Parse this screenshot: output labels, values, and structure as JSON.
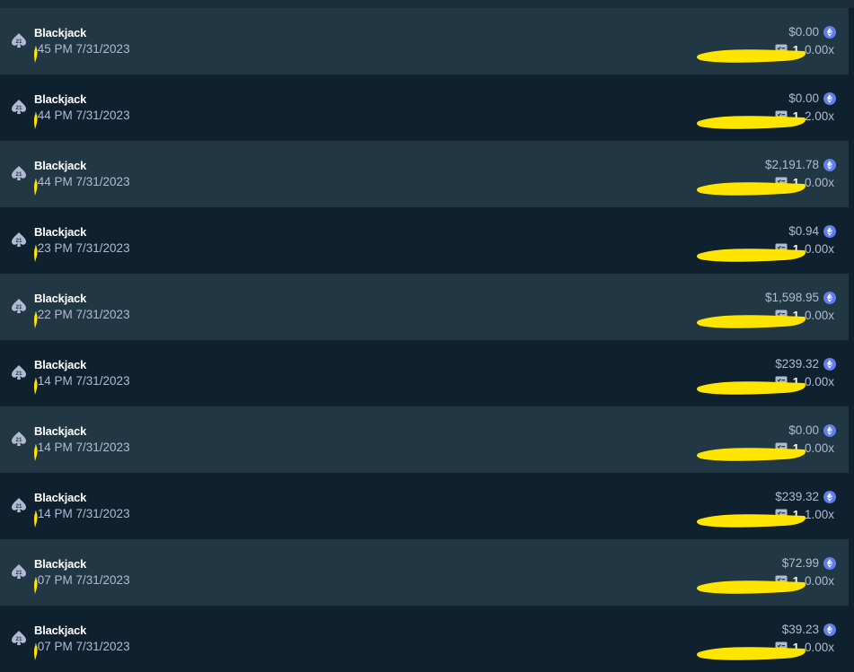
{
  "bets": [
    {
      "game": "Blackjack",
      "time": ":45 PM 7/31/2023",
      "payout": "$0.00",
      "bet_id": "1",
      "multiplier": "0.00x"
    },
    {
      "game": "Blackjack",
      "time": ":44 PM 7/31/2023",
      "payout": "$0.00",
      "bet_id": "1",
      "multiplier": "2.00x"
    },
    {
      "game": "Blackjack",
      "time": ":44 PM 7/31/2023",
      "payout": "$2,191.78",
      "bet_id": "1",
      "multiplier": "0.00x"
    },
    {
      "game": "Blackjack",
      "time": ":23 PM 7/31/2023",
      "payout": "$0.94",
      "bet_id": "1",
      "multiplier": "0.00x"
    },
    {
      "game": "Blackjack",
      "time": ":22 PM 7/31/2023",
      "payout": "$1,598.95",
      "bet_id": "1",
      "multiplier": "0.00x"
    },
    {
      "game": "Blackjack",
      "time": ":14 PM 7/31/2023",
      "payout": "$239.32",
      "bet_id": "1",
      "multiplier": "0.00x"
    },
    {
      "game": "Blackjack",
      "time": ":14 PM 7/31/2023",
      "payout": "$0.00",
      "bet_id": "1",
      "multiplier": "0.00x"
    },
    {
      "game": "Blackjack",
      "time": ":14 PM 7/31/2023",
      "payout": "$239.32",
      "bet_id": "1",
      "multiplier": "1.00x"
    },
    {
      "game": "Blackjack",
      "time": ":07 PM 7/31/2023",
      "payout": "$72.99",
      "bet_id": "1",
      "multiplier": "0.00x"
    },
    {
      "game": "Blackjack",
      "time": ":07 PM 7/31/2023",
      "payout": "$39.23",
      "bet_id": "1",
      "multiplier": "0.00x"
    }
  ],
  "icons": {
    "game": "blackjack-spade-21-icon",
    "currency": "ethereum-icon",
    "fairness": "provably-fair-icon"
  },
  "colors": {
    "row_light": "#213743",
    "row_dark": "#0f212e",
    "text_muted": "#b1bad3",
    "eth_accent": "#627eea",
    "redaction": "#ffe500"
  }
}
